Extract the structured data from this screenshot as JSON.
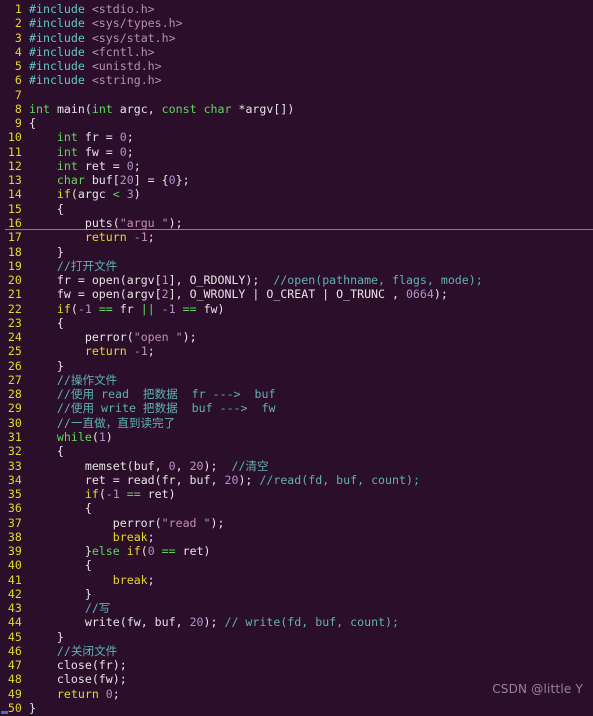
{
  "editor": {
    "background_color": "#2b0e29",
    "gutter_color": "#e3d82a",
    "text_color": "#e8e3e8",
    "cursor_line": 16,
    "total_lines": 50,
    "watermark": "CSDN @little Y"
  },
  "lines": [
    {
      "n": "1",
      "tokens": [
        {
          "t": "#include ",
          "c": "pre"
        },
        {
          "t": "<stdio.h>",
          "c": "hdr"
        }
      ]
    },
    {
      "n": "2",
      "tokens": [
        {
          "t": "#include ",
          "c": "pre"
        },
        {
          "t": "<sys/types.h>",
          "c": "hdr"
        }
      ]
    },
    {
      "n": "3",
      "tokens": [
        {
          "t": "#include ",
          "c": "pre"
        },
        {
          "t": "<sys/stat.h>",
          "c": "hdr"
        }
      ]
    },
    {
      "n": "4",
      "tokens": [
        {
          "t": "#include ",
          "c": "pre"
        },
        {
          "t": "<fcntl.h>",
          "c": "hdr"
        }
      ]
    },
    {
      "n": "5",
      "tokens": [
        {
          "t": "#include ",
          "c": "pre"
        },
        {
          "t": "<unistd.h>",
          "c": "hdr"
        }
      ]
    },
    {
      "n": "6",
      "tokens": [
        {
          "t": "#include ",
          "c": "pre"
        },
        {
          "t": "<string.h>",
          "c": "hdr"
        }
      ]
    },
    {
      "n": "7",
      "tokens": []
    },
    {
      "n": "8",
      "tokens": [
        {
          "t": "int",
          "c": "kw"
        },
        {
          "t": " ",
          "c": "pun"
        },
        {
          "t": "main",
          "c": "fn"
        },
        {
          "t": "(",
          "c": "pun"
        },
        {
          "t": "int",
          "c": "kw"
        },
        {
          "t": " argc, ",
          "c": "pun"
        },
        {
          "t": "const",
          "c": "kw"
        },
        {
          "t": " ",
          "c": "pun"
        },
        {
          "t": "char",
          "c": "kw"
        },
        {
          "t": " *argv[])",
          "c": "pun"
        }
      ]
    },
    {
      "n": "9",
      "tokens": [
        {
          "t": "{",
          "c": "brace"
        }
      ]
    },
    {
      "n": "10",
      "tokens": [
        {
          "t": "    ",
          "c": "pun"
        },
        {
          "t": "int",
          "c": "kw"
        },
        {
          "t": " fr = ",
          "c": "pun"
        },
        {
          "t": "0",
          "c": "num"
        },
        {
          "t": ";",
          "c": "pun"
        }
      ]
    },
    {
      "n": "11",
      "tokens": [
        {
          "t": "    ",
          "c": "pun"
        },
        {
          "t": "int",
          "c": "kw"
        },
        {
          "t": " fw = ",
          "c": "pun"
        },
        {
          "t": "0",
          "c": "num"
        },
        {
          "t": ";",
          "c": "pun"
        }
      ]
    },
    {
      "n": "12",
      "tokens": [
        {
          "t": "    ",
          "c": "pun"
        },
        {
          "t": "int",
          "c": "kw"
        },
        {
          "t": " ret = ",
          "c": "pun"
        },
        {
          "t": "0",
          "c": "num"
        },
        {
          "t": ";",
          "c": "pun"
        }
      ]
    },
    {
      "n": "13",
      "tokens": [
        {
          "t": "    ",
          "c": "pun"
        },
        {
          "t": "char",
          "c": "kw"
        },
        {
          "t": " buf[",
          "c": "pun"
        },
        {
          "t": "20",
          "c": "num"
        },
        {
          "t": "] = {",
          "c": "pun"
        },
        {
          "t": "0",
          "c": "num"
        },
        {
          "t": "};",
          "c": "pun"
        }
      ]
    },
    {
      "n": "14",
      "tokens": [
        {
          "t": "    ",
          "c": "pun"
        },
        {
          "t": "if",
          "c": "kw2"
        },
        {
          "t": "(argc ",
          "c": "pun"
        },
        {
          "t": "<",
          "c": "op"
        },
        {
          "t": " ",
          "c": "pun"
        },
        {
          "t": "3",
          "c": "num"
        },
        {
          "t": ")",
          "c": "pun"
        }
      ]
    },
    {
      "n": "15",
      "tokens": [
        {
          "t": "    {",
          "c": "brace"
        }
      ]
    },
    {
      "n": "16",
      "tokens": [
        {
          "t": "        ",
          "c": "pun"
        },
        {
          "t": "puts",
          "c": "fn"
        },
        {
          "t": "(",
          "c": "pun"
        },
        {
          "t": "\"argu \"",
          "c": "str"
        },
        {
          "t": ");",
          "c": "pun"
        }
      ]
    },
    {
      "n": "17",
      "tokens": [
        {
          "t": "        ",
          "c": "pun"
        },
        {
          "t": "return",
          "c": "kw2"
        },
        {
          "t": " ",
          "c": "pun"
        },
        {
          "t": "-1",
          "c": "num"
        },
        {
          "t": ";",
          "c": "pun"
        }
      ]
    },
    {
      "n": "18",
      "tokens": [
        {
          "t": "    }",
          "c": "brace"
        }
      ]
    },
    {
      "n": "19",
      "tokens": [
        {
          "t": "    ",
          "c": "pun"
        },
        {
          "t": "//打开文件",
          "c": "cmt"
        }
      ]
    },
    {
      "n": "20",
      "tokens": [
        {
          "t": "    fr = ",
          "c": "pun"
        },
        {
          "t": "open",
          "c": "fn"
        },
        {
          "t": "(argv[",
          "c": "pun"
        },
        {
          "t": "1",
          "c": "num"
        },
        {
          "t": "], O_RDONLY);  ",
          "c": "pun"
        },
        {
          "t": "//open(pathname, flags, mode);",
          "c": "cmt"
        }
      ]
    },
    {
      "n": "21",
      "tokens": [
        {
          "t": "    fw = ",
          "c": "pun"
        },
        {
          "t": "open",
          "c": "fn"
        },
        {
          "t": "(argv[",
          "c": "pun"
        },
        {
          "t": "2",
          "c": "num"
        },
        {
          "t": "], O_WRONLY | O_CREAT | O_TRUNC , ",
          "c": "pun"
        },
        {
          "t": "0664",
          "c": "num"
        },
        {
          "t": ");",
          "c": "pun"
        }
      ]
    },
    {
      "n": "22",
      "tokens": [
        {
          "t": "    ",
          "c": "pun"
        },
        {
          "t": "if",
          "c": "kw2"
        },
        {
          "t": "(",
          "c": "pun"
        },
        {
          "t": "-1",
          "c": "num"
        },
        {
          "t": " ",
          "c": "pun"
        },
        {
          "t": "==",
          "c": "op"
        },
        {
          "t": " fr ",
          "c": "pun"
        },
        {
          "t": "||",
          "c": "op"
        },
        {
          "t": " ",
          "c": "pun"
        },
        {
          "t": "-1",
          "c": "num"
        },
        {
          "t": " ",
          "c": "pun"
        },
        {
          "t": "==",
          "c": "op"
        },
        {
          "t": " fw)",
          "c": "pun"
        }
      ]
    },
    {
      "n": "23",
      "tokens": [
        {
          "t": "    {",
          "c": "brace"
        }
      ]
    },
    {
      "n": "24",
      "tokens": [
        {
          "t": "        ",
          "c": "pun"
        },
        {
          "t": "perror",
          "c": "fn"
        },
        {
          "t": "(",
          "c": "pun"
        },
        {
          "t": "\"open \"",
          "c": "str"
        },
        {
          "t": ");",
          "c": "pun"
        }
      ]
    },
    {
      "n": "25",
      "tokens": [
        {
          "t": "        ",
          "c": "pun"
        },
        {
          "t": "return",
          "c": "kw2"
        },
        {
          "t": " ",
          "c": "pun"
        },
        {
          "t": "-1",
          "c": "num"
        },
        {
          "t": ";",
          "c": "pun"
        }
      ]
    },
    {
      "n": "26",
      "tokens": [
        {
          "t": "    }",
          "c": "brace"
        }
      ]
    },
    {
      "n": "27",
      "tokens": [
        {
          "t": "    ",
          "c": "pun"
        },
        {
          "t": "//操作文件",
          "c": "cmt"
        }
      ]
    },
    {
      "n": "28",
      "tokens": [
        {
          "t": "    ",
          "c": "pun"
        },
        {
          "t": "//使用 read  把数据  fr --->  buf",
          "c": "cmt"
        }
      ]
    },
    {
      "n": "29",
      "tokens": [
        {
          "t": "    ",
          "c": "pun"
        },
        {
          "t": "//使用 write 把数据  buf --->  fw",
          "c": "cmt"
        }
      ]
    },
    {
      "n": "30",
      "tokens": [
        {
          "t": "    ",
          "c": "pun"
        },
        {
          "t": "//一直做，直到读完了",
          "c": "cmt"
        }
      ]
    },
    {
      "n": "31",
      "tokens": [
        {
          "t": "    ",
          "c": "pun"
        },
        {
          "t": "while",
          "c": "kw"
        },
        {
          "t": "(",
          "c": "pun"
        },
        {
          "t": "1",
          "c": "num"
        },
        {
          "t": ")",
          "c": "pun"
        }
      ]
    },
    {
      "n": "32",
      "tokens": [
        {
          "t": "    {",
          "c": "brace"
        }
      ]
    },
    {
      "n": "33",
      "tokens": [
        {
          "t": "        ",
          "c": "pun"
        },
        {
          "t": "memset",
          "c": "fn"
        },
        {
          "t": "(buf, ",
          "c": "pun"
        },
        {
          "t": "0",
          "c": "num"
        },
        {
          "t": ", ",
          "c": "pun"
        },
        {
          "t": "20",
          "c": "num"
        },
        {
          "t": ");  ",
          "c": "pun"
        },
        {
          "t": "//清空",
          "c": "cmt"
        }
      ]
    },
    {
      "n": "34",
      "tokens": [
        {
          "t": "        ret = ",
          "c": "pun"
        },
        {
          "t": "read",
          "c": "fn"
        },
        {
          "t": "(fr, buf, ",
          "c": "pun"
        },
        {
          "t": "20",
          "c": "num"
        },
        {
          "t": "); ",
          "c": "pun"
        },
        {
          "t": "//read(fd, buf, count);",
          "c": "cmt"
        }
      ]
    },
    {
      "n": "35",
      "tokens": [
        {
          "t": "        ",
          "c": "pun"
        },
        {
          "t": "if",
          "c": "kw2"
        },
        {
          "t": "(",
          "c": "pun"
        },
        {
          "t": "-1",
          "c": "num"
        },
        {
          "t": " ",
          "c": "pun"
        },
        {
          "t": "==",
          "c": "op"
        },
        {
          "t": " ret)",
          "c": "pun"
        }
      ]
    },
    {
      "n": "36",
      "tokens": [
        {
          "t": "        {",
          "c": "brace"
        }
      ]
    },
    {
      "n": "37",
      "tokens": [
        {
          "t": "            ",
          "c": "pun"
        },
        {
          "t": "perror",
          "c": "fn"
        },
        {
          "t": "(",
          "c": "pun"
        },
        {
          "t": "\"read \"",
          "c": "str"
        },
        {
          "t": ");",
          "c": "pun"
        }
      ]
    },
    {
      "n": "38",
      "tokens": [
        {
          "t": "            ",
          "c": "pun"
        },
        {
          "t": "break",
          "c": "kw2"
        },
        {
          "t": ";",
          "c": "pun"
        }
      ]
    },
    {
      "n": "39",
      "tokens": [
        {
          "t": "        }",
          "c": "brace"
        },
        {
          "t": "else",
          "c": "kw"
        },
        {
          "t": " ",
          "c": "pun"
        },
        {
          "t": "if",
          "c": "kw2"
        },
        {
          "t": "(",
          "c": "pun"
        },
        {
          "t": "0",
          "c": "num"
        },
        {
          "t": " ",
          "c": "pun"
        },
        {
          "t": "==",
          "c": "op"
        },
        {
          "t": " ret)",
          "c": "pun"
        }
      ]
    },
    {
      "n": "40",
      "tokens": [
        {
          "t": "        {",
          "c": "brace"
        }
      ]
    },
    {
      "n": "41",
      "tokens": [
        {
          "t": "            ",
          "c": "pun"
        },
        {
          "t": "break",
          "c": "kw2"
        },
        {
          "t": ";",
          "c": "pun"
        }
      ]
    },
    {
      "n": "42",
      "tokens": [
        {
          "t": "        }",
          "c": "brace"
        }
      ]
    },
    {
      "n": "43",
      "tokens": [
        {
          "t": "        ",
          "c": "pun"
        },
        {
          "t": "//写",
          "c": "cmt"
        }
      ]
    },
    {
      "n": "44",
      "tokens": [
        {
          "t": "        ",
          "c": "pun"
        },
        {
          "t": "write",
          "c": "fn"
        },
        {
          "t": "(fw, buf, ",
          "c": "pun"
        },
        {
          "t": "20",
          "c": "num"
        },
        {
          "t": "); ",
          "c": "pun"
        },
        {
          "t": "// write(fd, buf, count);",
          "c": "cmt"
        }
      ]
    },
    {
      "n": "45",
      "tokens": [
        {
          "t": "    }",
          "c": "brace"
        }
      ]
    },
    {
      "n": "46",
      "tokens": [
        {
          "t": "    ",
          "c": "pun"
        },
        {
          "t": "//关闭文件",
          "c": "cmt"
        }
      ]
    },
    {
      "n": "47",
      "tokens": [
        {
          "t": "    ",
          "c": "pun"
        },
        {
          "t": "close",
          "c": "fn"
        },
        {
          "t": "(fr);",
          "c": "pun"
        }
      ]
    },
    {
      "n": "48",
      "tokens": [
        {
          "t": "    ",
          "c": "pun"
        },
        {
          "t": "close",
          "c": "fn"
        },
        {
          "t": "(fw);",
          "c": "pun"
        }
      ]
    },
    {
      "n": "49",
      "tokens": [
        {
          "t": "    ",
          "c": "pun"
        },
        {
          "t": "return",
          "c": "kw2"
        },
        {
          "t": " ",
          "c": "pun"
        },
        {
          "t": "0",
          "c": "num"
        },
        {
          "t": ";",
          "c": "pun"
        }
      ]
    },
    {
      "n": "50",
      "tokens": [
        {
          "t": "}",
          "c": "brace"
        }
      ]
    }
  ]
}
